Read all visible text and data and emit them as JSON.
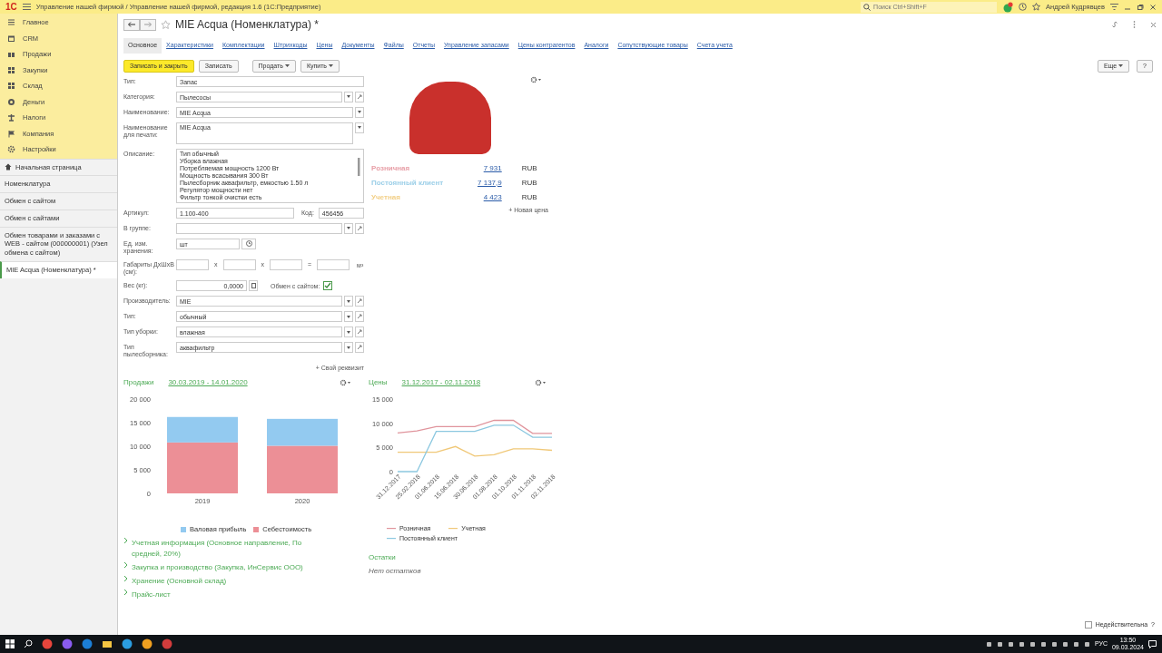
{
  "titlebar": {
    "logo": "1С",
    "title": "Управление нашей фирмой / Управление нашей фирмой, редакция 1.6  (1С:Предприятие)",
    "search_placeholder": "Поиск Ctrl+Shift+F",
    "user": "Андрей Кудрявцев"
  },
  "sections": [
    {
      "label": "Главное"
    },
    {
      "label": "CRM"
    },
    {
      "label": "Продажи"
    },
    {
      "label": "Закупки"
    },
    {
      "label": "Склад"
    },
    {
      "label": "Деньги"
    },
    {
      "label": "Налоги"
    },
    {
      "label": "Компания"
    },
    {
      "label": "Настройки"
    }
  ],
  "open_windows": [
    {
      "label": "Начальная страница",
      "kind": "home",
      "selected": false
    },
    {
      "label": "Номенклатура",
      "kind": "plain",
      "selected": false
    },
    {
      "label": "Обмен с сайтом",
      "kind": "plain",
      "selected": false
    },
    {
      "label": "Обмен с сайтами",
      "kind": "plain",
      "selected": false
    },
    {
      "label": "Обмен товарами и заказами с WEB - сайтом (000000001) (Узел обмена с сайтом)",
      "kind": "plain",
      "selected": false
    },
    {
      "label": "MIE Acqua (Номенклатура) *",
      "kind": "plain",
      "selected": true
    }
  ],
  "form": {
    "title": "MIE Acqua (Номенклатура) *",
    "favorite": false,
    "tabs": [
      {
        "label": "Основное",
        "selected": true
      },
      {
        "label": "Характеристики",
        "selected": false
      },
      {
        "label": "Комплектации",
        "selected": false
      },
      {
        "label": "Штрихкоды",
        "selected": false
      },
      {
        "label": "Цены",
        "selected": false
      },
      {
        "label": "Документы",
        "selected": false
      },
      {
        "label": "Файлы",
        "selected": false
      },
      {
        "label": "Отчеты",
        "selected": false
      },
      {
        "label": "Управление запасами",
        "selected": false
      },
      {
        "label": "Цены контрагентов",
        "selected": false
      },
      {
        "label": "Аналоги",
        "selected": false
      },
      {
        "label": "Сопутствующие товары",
        "selected": false
      },
      {
        "label": "Счета учета",
        "selected": false
      }
    ],
    "buttons": [
      {
        "label": "Записать и закрыть",
        "kind": "primary"
      },
      {
        "label": "Записать",
        "kind": "plain"
      },
      {
        "label": "Продать",
        "kind": "dropdown"
      },
      {
        "label": "Купить",
        "kind": "dropdown"
      }
    ],
    "more": "Еще",
    "help": "?",
    "fields": [
      {
        "label": "Тип:",
        "kind": "plain",
        "value": "Запас"
      },
      {
        "label": "Категория:",
        "kind": "select",
        "value": "Пылесосы"
      },
      {
        "label": "Наименование:",
        "kind": "dropdown",
        "value": "MIE Acqua"
      },
      {
        "label": "Наименование для печати:",
        "kind": "memo",
        "value": "MIE Acqua"
      },
      {
        "label": "Описание:",
        "kind": "lines",
        "lines": [
          "Тип обычный",
          "Уборка влажная",
          "Потребляемая мощность 1200 Вт",
          "Мощность всасывания 300 Вт",
          "Пылесборник аквафильтр, емкостью 1.50 л",
          "Регулятор мощности нет",
          "Фильтр тонкой очистки есть"
        ]
      },
      {
        "label": "Артикул:",
        "kind": "pair",
        "value": "1.100-400",
        "label2": "Код:",
        "value2": "456456"
      },
      {
        "label": "В группе:",
        "kind": "select"
      },
      {
        "label": "Ед. изм. хранения:",
        "kind": "unit",
        "value": "шт"
      },
      {
        "label": "Габариты ДхШхВ (см):",
        "kind": "dims",
        "separators": [
          "x",
          "x",
          "="
        ],
        "unit": "м³"
      },
      {
        "label": "Вес (кг):",
        "kind": "weight",
        "value": "0,0000",
        "check_label": "Обмен с сайтом:",
        "checked": true
      },
      {
        "label": "Производитель:",
        "kind": "select",
        "value": "MIE"
      },
      {
        "label": "Тип:",
        "kind": "select",
        "value": "обычный"
      },
      {
        "label": "Тип уборки:",
        "kind": "select",
        "value": "влажная"
      },
      {
        "label": "Тип пылесборника:",
        "kind": "select",
        "value": "аквафильтр"
      }
    ],
    "own_attribute": "+ Свой реквизит",
    "prices": [
      {
        "name": "Розничная",
        "color": "#e8a0a8",
        "value": "7 931",
        "currency": "RUB"
      },
      {
        "name": "Постоянный клиент",
        "color": "#9ccfe8",
        "value": "7 137,9",
        "currency": "RUB"
      },
      {
        "name": "Учетная",
        "color": "#f2cf86",
        "value": "4 423",
        "currency": "RUB"
      }
    ],
    "new_price": "+ Новая цена",
    "sales": {
      "title": "Продажи",
      "period": "30.03.2019 - 14.01.2020",
      "chart_data": {
        "type": "bar",
        "stacked": true,
        "categories": [
          "2019",
          "2020"
        ],
        "yticks": [
          {
            "value": 0,
            "label": "0"
          },
          {
            "value": 5000,
            "label": "5 000"
          },
          {
            "value": 10000,
            "label": "10 000"
          },
          {
            "value": 15000,
            "label": "15 000"
          },
          {
            "value": 20000,
            "label": "20 000"
          }
        ],
        "ylim": [
          0,
          20000
        ],
        "series": [
          {
            "name": "Себестоимость",
            "color": "#ec8f96",
            "values": [
              10800,
              10100
            ]
          },
          {
            "name": "Валовая прибыль",
            "color": "#93caf0",
            "values": [
              5400,
              5700
            ]
          }
        ]
      }
    },
    "price_chart": {
      "title": "Цены",
      "period": "31.12.2017 - 02.11.2018",
      "chart_data": {
        "type": "line",
        "categories": [
          "31.12.2017",
          "25.02.2018",
          "01.06.2018",
          "15.06.2018",
          "30.06.2018",
          "01.08.2018",
          "01.10.2018",
          "01.11.2018",
          "02.11.2018"
        ],
        "yticks": [
          {
            "value": 0,
            "label": "0"
          },
          {
            "value": 5000,
            "label": "5 000"
          },
          {
            "value": 10000,
            "label": "10 000"
          },
          {
            "value": 15000,
            "label": "15 000"
          }
        ],
        "ylim": [
          0,
          15000
        ],
        "series": [
          {
            "name": "Розничная",
            "color": "#e0949c",
            "values": [
              8000,
              8400,
              9300,
              9300,
              9300,
              10600,
              10600,
              7900,
              7900
            ]
          },
          {
            "name": "Учетная",
            "color": "#f0c878",
            "values": [
              4000,
              4000,
              4000,
              5200,
              3200,
              3500,
              4700,
              4700,
              4400
            ]
          },
          {
            "name": "Постоянный клиент",
            "color": "#8cc8e0",
            "values": [
              0,
              0,
              8300,
              8300,
              8300,
              9600,
              9600,
              7100,
              7100
            ]
          }
        ]
      }
    },
    "groups": [
      {
        "label": "Учетная информация (Основное направление, По средней, 20%)",
        "expanded": false
      },
      {
        "label": "Закупка и производство (Закупка, ИнСервис ООО)",
        "expanded": false
      },
      {
        "label": "Хранение (Основной склад)",
        "expanded": false
      },
      {
        "label": "Прайс-лист",
        "expanded": false
      }
    ],
    "stock": {
      "title": "Остатки",
      "text": "Нет остатков"
    },
    "invalid": {
      "label": "Недействительна",
      "checked": false
    },
    "footer_help": "?"
  },
  "taskbar": {
    "language": "РУС",
    "time": "13:50",
    "date": "09.03.2024"
  }
}
